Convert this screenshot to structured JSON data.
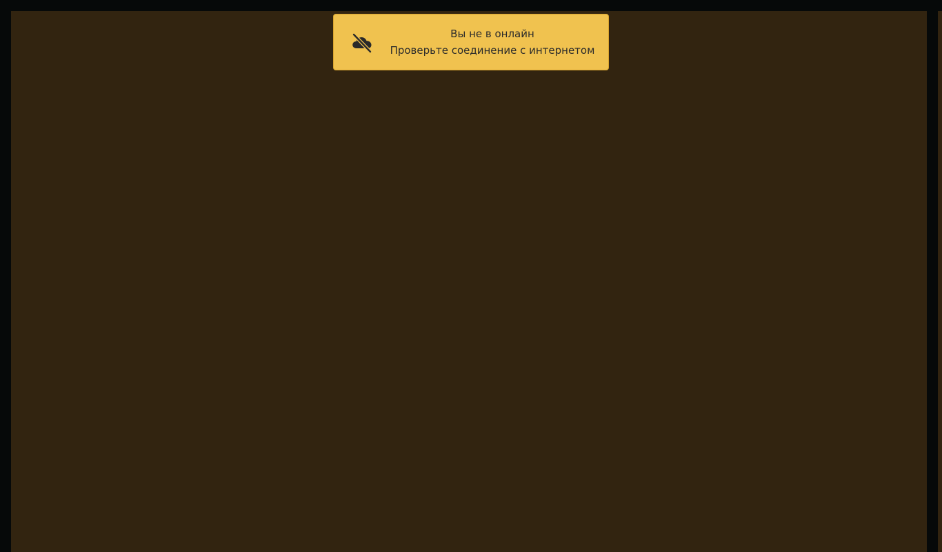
{
  "toast": {
    "icon": "cloud-offline-icon",
    "title": "Вы не в онлайн",
    "message": "Проверьте соединение с интернетом",
    "background_color": "#f0c24f"
  },
  "colors": {
    "page_background": "#060909",
    "content_background": "#322410"
  }
}
